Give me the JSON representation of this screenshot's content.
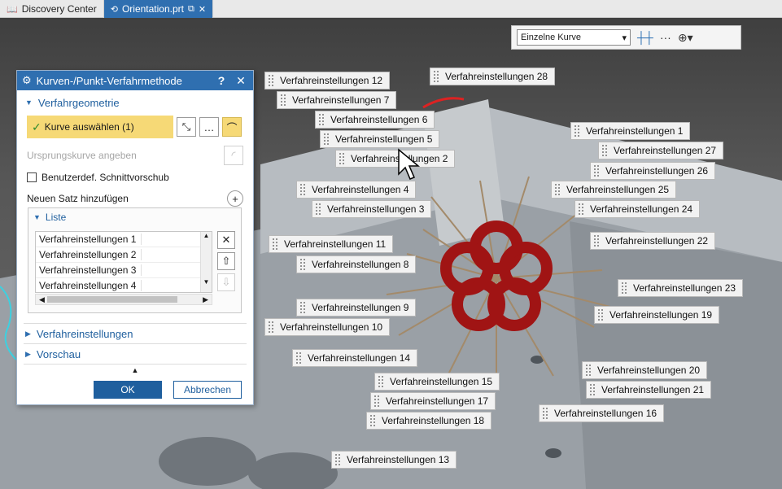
{
  "tabs": [
    {
      "label": "Discovery Center"
    },
    {
      "label": "Orientation.prt"
    }
  ],
  "selection_bar": {
    "filter_value": "Einzelne Kurve"
  },
  "dialog": {
    "title": "Kurven-/Punkt-Verfahrmethode",
    "help": "?",
    "close": "✕",
    "group_geometry": "Verfahrgeometrie",
    "select_curve": "Kurve auswählen (1)",
    "origin_curve": "Ursprungskurve angeben",
    "custom_feed": "Benutzerdef. Schnittvorschub",
    "new_set": "Neuen Satz hinzufügen",
    "list_title": "Liste",
    "list_items": [
      "Verfahreinstellungen 1",
      "Verfahreinstellungen 2",
      "Verfahreinstellungen 3",
      "Verfahreinstellungen 4"
    ],
    "group_settings": "Verfahreinstellungen",
    "group_preview": "Vorschau",
    "ok": "OK",
    "cancel": "Abbrechen"
  },
  "callouts": [
    "Verfahreinstellungen 12",
    "Verfahreinstellungen 28",
    "Verfahreinstellungen 7",
    "Verfahreinstellungen 6",
    "Verfahreinstellungen 5",
    "Verfahreinstellungen 2",
    "Verfahreinstellungen 1",
    "Verfahreinstellungen 27",
    "Verfahreinstellungen 26",
    "Verfahreinstellungen 4",
    "Verfahreinstellungen 25",
    "Verfahreinstellungen 3",
    "Verfahreinstellungen 24",
    "Verfahreinstellungen 11",
    "Verfahreinstellungen 22",
    "Verfahreinstellungen 8",
    "Verfahreinstellungen 23",
    "Verfahreinstellungen 9",
    "Verfahreinstellungen 19",
    "Verfahreinstellungen 10",
    "Verfahreinstellungen 14",
    "Verfahreinstellungen 20",
    "Verfahreinstellungen 15",
    "Verfahreinstellungen 21",
    "Verfahreinstellungen 17",
    "Verfahreinstellungen 16",
    "Verfahreinstellungen 18",
    "Verfahreinstellungen 13"
  ]
}
